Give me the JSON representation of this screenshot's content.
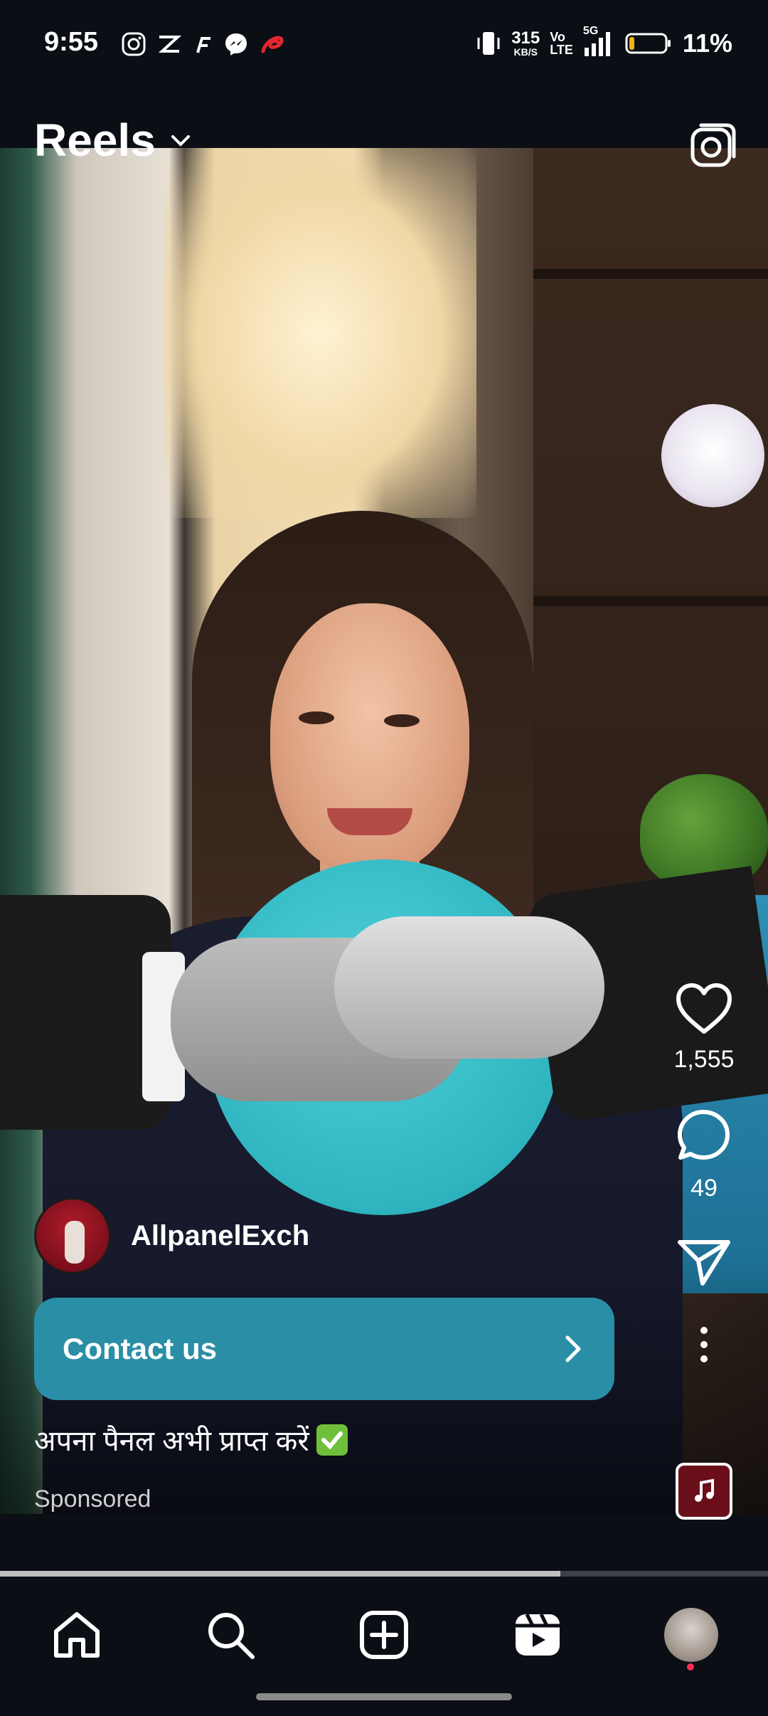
{
  "status_bar": {
    "time": "9:55",
    "net_speed_value": "315",
    "net_speed_unit": "KB/S",
    "volte_top": "Vo",
    "volte_bottom": "LTE",
    "network": "5G",
    "battery_percent": "11%"
  },
  "header": {
    "title": "Reels"
  },
  "reel": {
    "likes": "1,555",
    "comments": "49",
    "author": "AllpanelExch",
    "cta_label": "Contact us",
    "caption": "अपना पैनल अभी प्राप्त करें",
    "sponsored_label": "Sponsored",
    "progress_fraction": 0.73
  },
  "icons": {
    "status_left": [
      "instagram-icon",
      "zomato-icon",
      "flipkart-icon",
      "messenger-icon",
      "airtel-icon"
    ],
    "header_right": "camera-icon",
    "rail": [
      "heart-icon",
      "comment-icon",
      "send-icon",
      "more-icon",
      "music-thumbnail-icon"
    ],
    "nav": [
      "home-icon",
      "search-icon",
      "create-icon",
      "reels-icon",
      "profile-avatar"
    ]
  },
  "colors": {
    "cta_background": "#2a8ea6",
    "background": "#0b0f15",
    "notification_dot": "#ff2d55"
  }
}
